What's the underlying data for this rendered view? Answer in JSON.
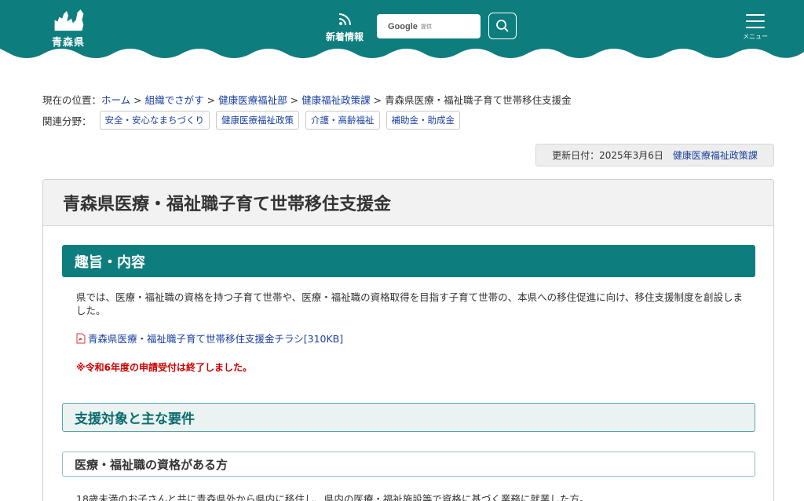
{
  "header": {
    "logo_text": "青森県",
    "news_label": "新着情報",
    "search_brand": "Google",
    "search_brand_sub": "提供",
    "menu_label": "メニュー",
    "colors": {
      "teal": "#0e7d7e",
      "white": "#ffffff"
    }
  },
  "breadcrumb": {
    "prefix": "現在の位置：",
    "items": [
      {
        "label": "ホーム"
      },
      {
        "label": "組織でさがす"
      },
      {
        "label": "健康医療福祉部"
      },
      {
        "label": "健康福祉政策課"
      }
    ],
    "current": "青森県医療・福祉職子育て世帯移住支援金",
    "separator": ">"
  },
  "related": {
    "label": "関連分野：",
    "tags": [
      "安全・安心なまちづくり",
      "健康医療福祉政策",
      "介護・高齢福祉",
      "補助金・助成金"
    ]
  },
  "updated": {
    "text": "更新日付：2025年3月6日",
    "dept": "健康医療福祉政策課"
  },
  "page": {
    "title": "青森県医療・福祉職子育て世帯移住支援金",
    "section1_heading": "趣旨・内容",
    "section1_body": "県では、医療・福祉職の資格を持つ子育て世帯や、医療・福祉職の資格取得を目指す子育て世帯の、本県への移住促進に向け、移住支援制度を創設しました。",
    "pdf_link": "青森県医療・福祉職子育て世帯移住支援金チラシ[310KB]",
    "notice": "※令和6年度の申請受付は終了しました。",
    "section2_heading": "支援対象と主な要件",
    "section3_heading": "医療・福祉職の資格がある方",
    "section3_body": "18歳未満のお子さんと共に青森県外から県内に移住し、県内の医療・福祉施設等で資格に基づく業務に就業した方。"
  }
}
